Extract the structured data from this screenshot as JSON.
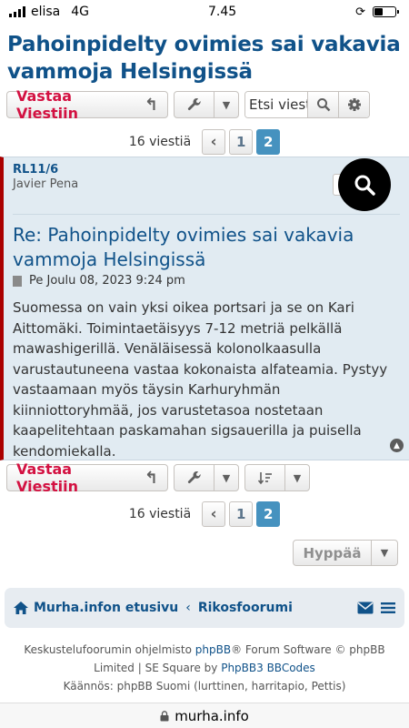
{
  "status": {
    "carrier": "elisa",
    "network": "4G",
    "time": "7.45"
  },
  "page": {
    "title": "Pahoinpidelty ovimies sai vakavia vammoja Helsingissä"
  },
  "toolbar": {
    "reply_label": "Vastaa Viestiin",
    "search_placeholder": "Etsi viest"
  },
  "pagination": {
    "count_text": "16 viestiä",
    "pages": [
      "1",
      "2"
    ]
  },
  "post": {
    "rank": "RL11/6",
    "author": "Javier Pena",
    "title": "Re: Pahoinpidelty ovimies sai vakavia vammoja Helsingissä",
    "date": "Pe Joulu 08, 2023 9:24 pm",
    "content": "Suomessa on vain yksi oikea portsari ja se on Kari Aittomäki. Toimintaetäisyys 7-12 metriä pelkällä mawashigerillä. Venäläisessä kolonolkaasulla varustautuneena vastaa kokonaista alfateamia. Pystyy vastaamaan myös täysin Karhuryhmän kiinniottoryhmää, jos varustetasoa nostetaan kaapelitehtaan paskamahan sigsauerilla ja puisella kendomiekalla."
  },
  "jump": {
    "label": "Hyppää"
  },
  "nav": {
    "home": "Murha.infon etusivu",
    "crumb": "Rikosfoorumi"
  },
  "footer": {
    "line1_pre": "Keskustelufoorumin ohjelmisto ",
    "phpbb": "phpBB",
    "line1_post": "® Forum Software © phpBB",
    "line2_pre": "Limited | SE Square by ",
    "bbcodes": "PhpBB3 BBCodes",
    "line3": "Käännös: phpBB Suomi (lurttinen, harritapio, Pettis)"
  },
  "browser": {
    "url": "murha.info"
  },
  "colors": {
    "brand": "#105289",
    "reply_red": "#d31141",
    "active_page": "#4692bf",
    "post_bg": "#e1ebf2",
    "post_border": "#aa0000"
  }
}
